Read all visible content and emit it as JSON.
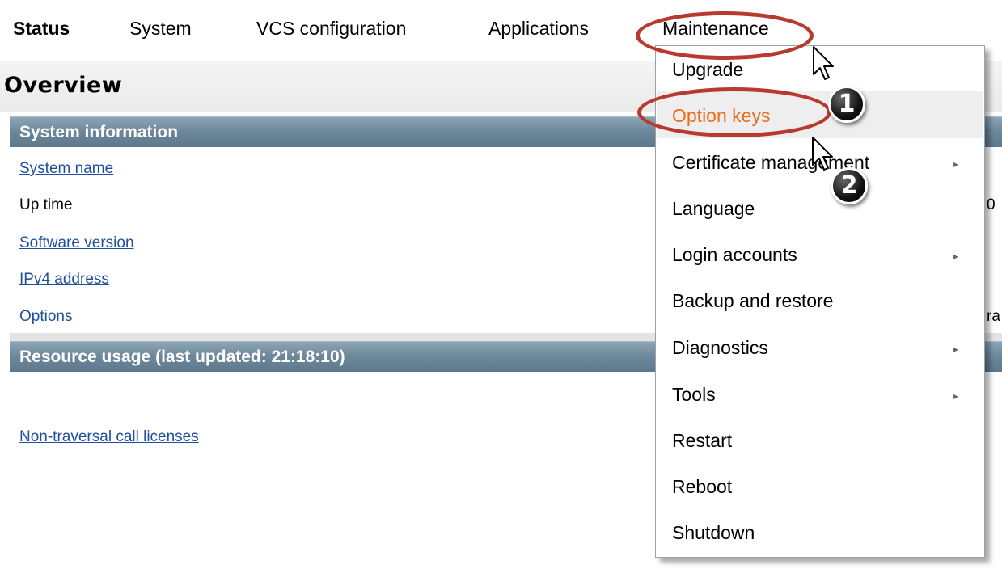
{
  "nav": {
    "items": [
      {
        "label": "Status"
      },
      {
        "label": "System"
      },
      {
        "label": "VCS configuration"
      },
      {
        "label": "Applications"
      },
      {
        "label": "Maintenance"
      }
    ]
  },
  "page": {
    "title": "Overview"
  },
  "system_info": {
    "header": "System information",
    "rows": [
      {
        "label": "System name"
      },
      {
        "label": "Up time"
      },
      {
        "label": "Software version"
      },
      {
        "label": "IPv4 address"
      },
      {
        "label": "Options"
      }
    ],
    "truncated_values": [
      "0",
      "ra"
    ]
  },
  "resource_usage": {
    "header": "Resource usage (last updated: 21:18:10)",
    "rows": [
      {
        "label": "Non-traversal call licenses"
      }
    ]
  },
  "maintenance_menu": {
    "items": [
      {
        "label": "Upgrade",
        "has_submenu": false
      },
      {
        "label": "Option keys",
        "has_submenu": false
      },
      {
        "label": "Certificate management",
        "has_submenu": true
      },
      {
        "label": "Language",
        "has_submenu": false
      },
      {
        "label": "Login accounts",
        "has_submenu": true
      },
      {
        "label": "Backup and restore",
        "has_submenu": false
      },
      {
        "label": "Diagnostics",
        "has_submenu": true
      },
      {
        "label": "Tools",
        "has_submenu": true
      },
      {
        "label": "Restart",
        "has_submenu": false
      },
      {
        "label": "Reboot",
        "has_submenu": false
      },
      {
        "label": "Shutdown",
        "has_submenu": false
      }
    ],
    "submenu_arrow": "▸"
  },
  "annotations": {
    "step1": "1",
    "step2": "2",
    "ellipse_color": "#b83a2e"
  },
  "colors": {
    "link": "#1f4f9c",
    "active_menu": "#ee6a1c",
    "section_header": "#6f899c"
  }
}
